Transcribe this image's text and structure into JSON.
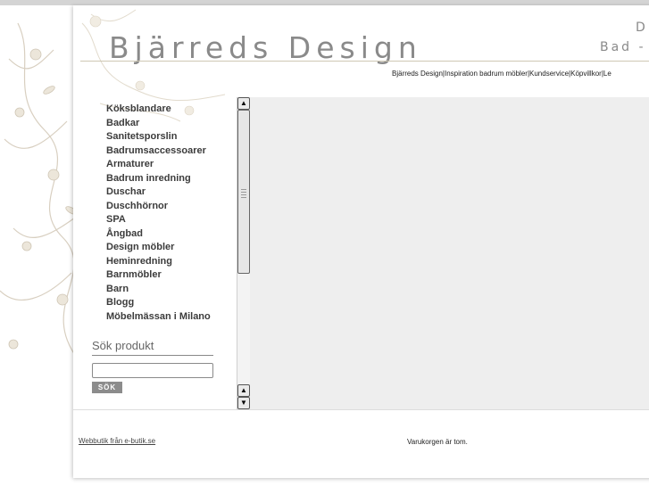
{
  "header": {
    "logo": "Bjärreds Design",
    "tagline_line1": "D",
    "tagline_line2": "Bad - H"
  },
  "topnav": {
    "items": [
      "Bjärreds Design",
      "Inspiration badrum möbler",
      "Kundservice",
      "Köpvillkor",
      "Le"
    ],
    "separator": "|"
  },
  "sidebar": {
    "categories": [
      "Köksblandare",
      "Badkar",
      "Sanitetsporslin",
      "Badrumsaccessoarer",
      "Armaturer",
      "Badrum inredning",
      "Duschar",
      "Duschhörnor",
      "SPA",
      "Ångbad",
      "Design möbler",
      "Heminredning",
      "Barnmöbler",
      "Barn",
      "Blogg",
      "Möbelmässan i Milano"
    ]
  },
  "search": {
    "title": "Sök produkt",
    "value": "",
    "button_label": "SÖK"
  },
  "footer": {
    "link": "Webbutik från e-butik.se",
    "cart_status": "Varukorgen är tom."
  },
  "colors": {
    "logo": "#8a8a8a",
    "content_bg": "#eeeeee",
    "button_bg": "#8c8c8c"
  },
  "icons": {
    "scroll_up": "triangle-up",
    "scroll_down": "triangle-down"
  }
}
